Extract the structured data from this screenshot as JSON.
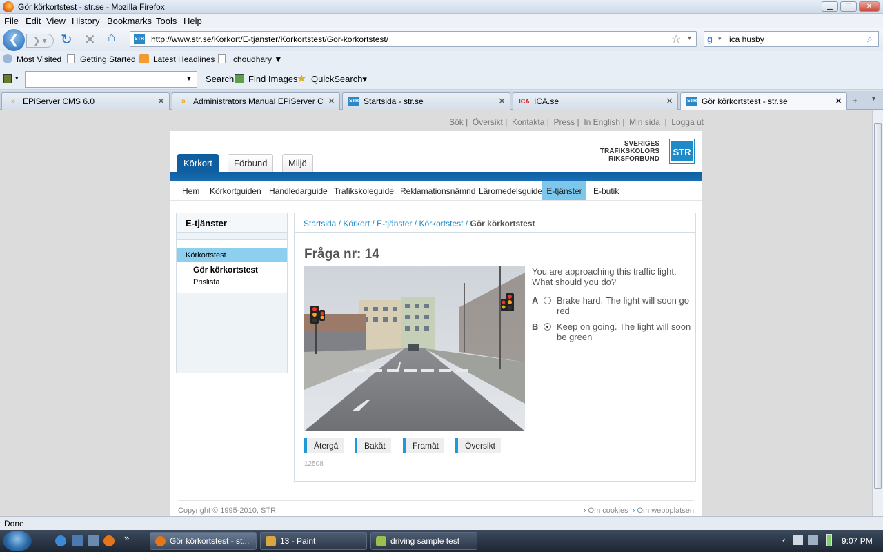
{
  "window": {
    "title": "Gör körkortstest - str.se - Mozilla Firefox"
  },
  "menu": [
    "File",
    "Edit",
    "View",
    "History",
    "Bookmarks",
    "Tools",
    "Help"
  ],
  "nav": {
    "url": "http://www.str.se/Korkort/E-tjanster/Korkortstest/Gor-korkortstest/",
    "search_value": "ica husby"
  },
  "bookmarks": [
    "Most Visited",
    "Getting Started",
    "Latest Headlines",
    "choudhary ▼"
  ],
  "toolbar2": {
    "search_label": "Search",
    "find_images": "Find Images",
    "quicksearch": "QuickSearch▾"
  },
  "tabs": [
    {
      "label": "EPiServer CMS 6.0"
    },
    {
      "label": "Administrators Manual EPiServer C..."
    },
    {
      "label": "Startsida - str.se"
    },
    {
      "label": "ICA.se"
    },
    {
      "label": "Gör körkortstest - str.se"
    }
  ],
  "site": {
    "top_links": [
      "Sök",
      "Översikt",
      "Kontakta",
      "Press",
      "In English",
      "Min sida",
      "Logga ut"
    ],
    "logo": {
      "line1": "SVERIGES",
      "line2": "TRAFIKSKOLORS",
      "line3": "RIKSFÖRBUND",
      "mark": "STR"
    },
    "main_tabs": [
      "Körkort",
      "Förbund",
      "Miljö"
    ],
    "sub_nav": [
      "Hem",
      "Körkortguiden",
      "Handledarguide",
      "Trafikskoleguide",
      "Reklamationsnämnd",
      "Läromedelsguide",
      "E-tjänster",
      "E-butik"
    ],
    "sidebar": {
      "title": "E-tjänster",
      "selected": "Körkortstest",
      "children": [
        "Gör körkortstest",
        "Prislista"
      ]
    },
    "breadcrumb": [
      "Startsida",
      "Körkort",
      "E-tjänster",
      "Körkortstest"
    ],
    "breadcrumb_current": "Gör körkortstest",
    "question": {
      "title": "Fråga nr: 14",
      "text": "You are approaching this traffic light. What should you do?",
      "options": [
        {
          "letter": "A",
          "text": "Brake hard. The light will soon go red",
          "selected": false
        },
        {
          "letter": "B",
          "text": "Keep on going. The light will soon be green",
          "selected": true
        }
      ],
      "id": "12508"
    },
    "buttons": [
      "Återgå",
      "Bakåt",
      "Framåt",
      "Översikt"
    ],
    "footer": {
      "copyright": "Copyright © 1995-2010, STR",
      "links": [
        "Om cookies",
        "Om webbplatsen"
      ]
    }
  },
  "status": "Done",
  "taskbar": {
    "tasks": [
      "Gör körkortstest - st...",
      "13 - Paint",
      "driving sample test"
    ],
    "clock": "9:07 PM"
  }
}
